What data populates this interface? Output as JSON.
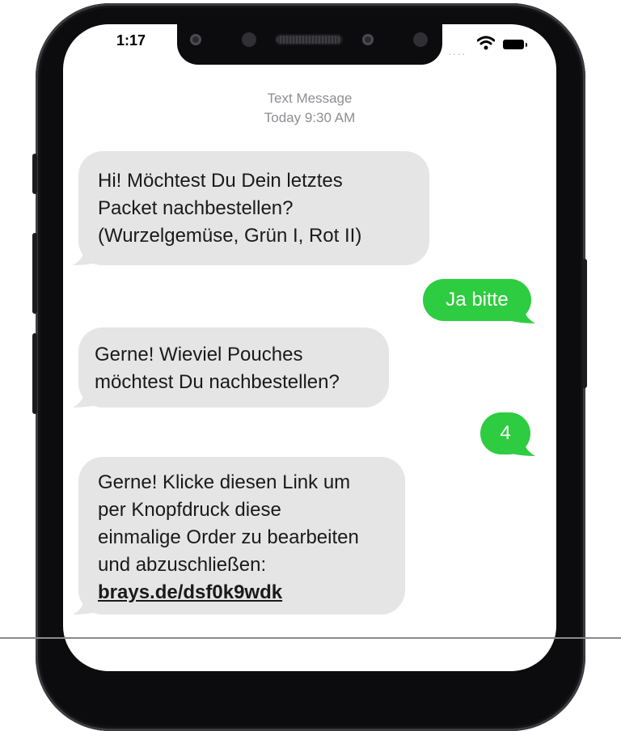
{
  "status_bar": {
    "time": "1:17",
    "signal": "····"
  },
  "thread_header": {
    "service": "Text Message",
    "timestamp": "Today 9:30 AM"
  },
  "messages": [
    {
      "direction": "incoming",
      "lines": [
        "Hi! Möchtest Du Dein letztes",
        "Packet nachbestellen?",
        "(Wurzelgemüse, Grün I, Rot II)"
      ]
    },
    {
      "direction": "outgoing",
      "text": "Ja bitte"
    },
    {
      "direction": "incoming",
      "lines": [
        "Gerne! Wieviel Pouches",
        "möchtest Du nachbestellen?"
      ]
    },
    {
      "direction": "outgoing",
      "text": "4"
    },
    {
      "direction": "incoming",
      "lines": [
        "Gerne! Klicke diesen Link um",
        "per Knopfdruck diese",
        "einmalige Order zu bearbeiten",
        "und abzuschließen:"
      ],
      "link": "brays.de/dsf0k9wdk"
    }
  ],
  "colors": {
    "incoming_bubble": "#e5e5e5",
    "outgoing_bubble": "#2ecc40",
    "frame": "#0c0c0e",
    "header_text": "#8e8e93"
  },
  "icons": [
    "wifi-icon",
    "battery-icon",
    "front-camera-icon",
    "speaker-grille"
  ]
}
